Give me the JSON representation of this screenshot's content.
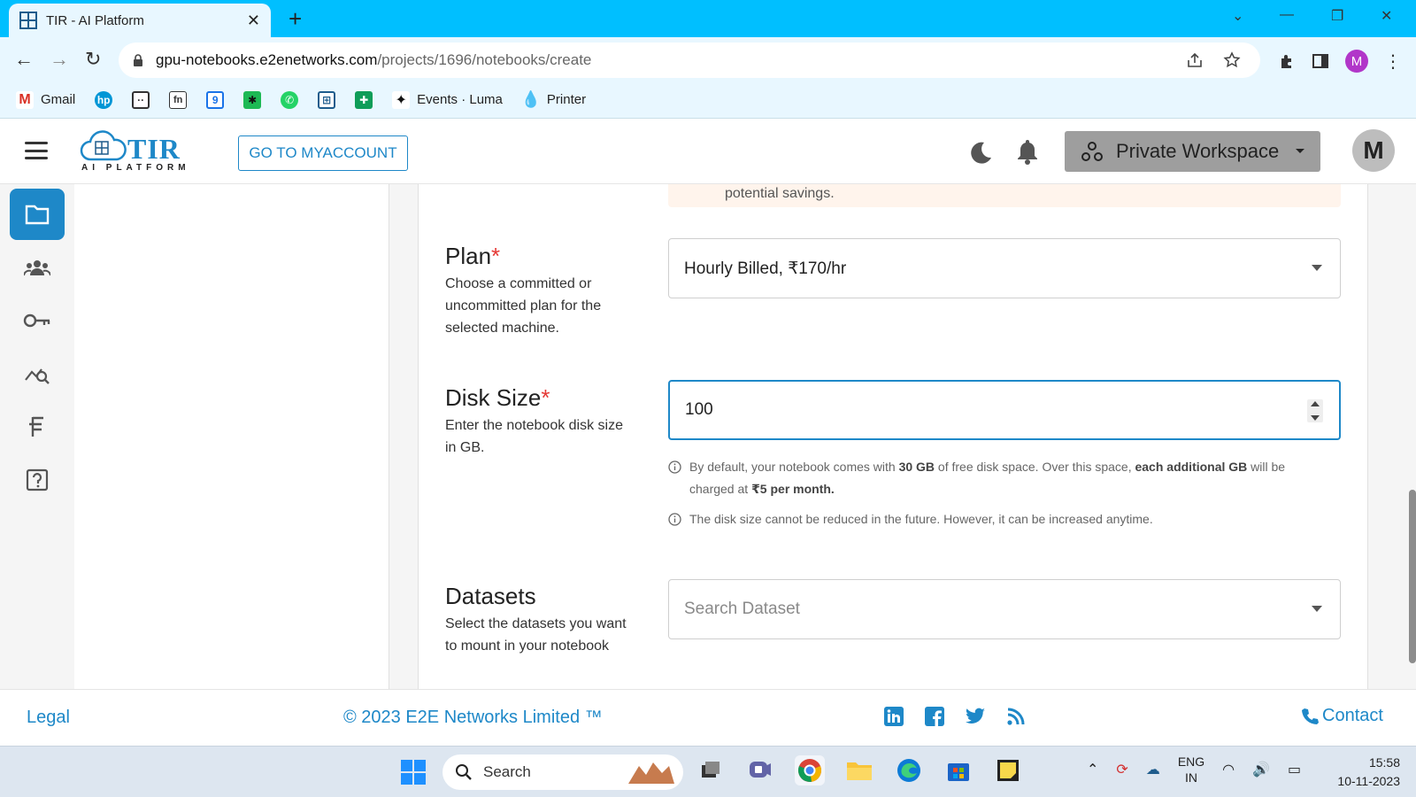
{
  "browser": {
    "tab_title": "TIR - AI Platform",
    "url_host": "gpu-notebooks.e2enetworks.com",
    "url_path": "/projects/1696/notebooks/create",
    "profile_initial": "M",
    "bookmarks": [
      {
        "label": "Gmail",
        "icon": "gmail-icon"
      },
      {
        "label": "",
        "icon": "hp-icon"
      },
      {
        "label": "",
        "icon": "chat-icon"
      },
      {
        "label": "",
        "icon": "fn-icon"
      },
      {
        "label": "",
        "icon": "calendar-9-icon"
      },
      {
        "label": "",
        "icon": "green-star-icon"
      },
      {
        "label": "",
        "icon": "whatsapp-icon"
      },
      {
        "label": "",
        "icon": "tir-icon"
      },
      {
        "label": "",
        "icon": "sheets-icon"
      },
      {
        "label": "Events · Luma",
        "icon": "luma-icon"
      },
      {
        "label": "Printer",
        "icon": "printer-drop-icon"
      }
    ]
  },
  "header": {
    "logo_text": "TIR",
    "logo_sub": "AI PLATFORM",
    "goto_label": "GO TO MYACCOUNT",
    "workspace_label": "Private Workspace",
    "avatar_initial": "M"
  },
  "alert": {
    "partial_text": "potential savings."
  },
  "form": {
    "plan": {
      "label": "Plan",
      "required_mark": "*",
      "description": "Choose a committed or uncommitted plan for the selected machine.",
      "value": "Hourly Billed, ₹170/hr"
    },
    "disk": {
      "label": "Disk Size",
      "required_mark": "*",
      "description": "Enter the notebook disk size in GB.",
      "value": "100",
      "help1_pre": "By default, your notebook comes with ",
      "help1_b1": "30 GB",
      "help1_mid": " of free disk space. Over this space, ",
      "help1_b2": "each additional GB",
      "help1_post": " will be charged at ",
      "help1_b3": "₹5 per month.",
      "help2": "The disk size cannot be reduced in the future. However, it can be increased anytime."
    },
    "datasets": {
      "label": "Datasets",
      "description": "Select the datasets you want to mount in your notebook",
      "placeholder": "Search Dataset"
    }
  },
  "footer": {
    "legal": "Legal",
    "copyright": "© 2023 E2E Networks Limited ™",
    "contact": "Contact"
  },
  "taskbar": {
    "search_label": "Search",
    "lang_top": "ENG",
    "lang_bottom": "IN",
    "time": "15:58",
    "date": "10-11-2023"
  },
  "colors": {
    "accent": "#1e88c8",
    "tabbar": "#00bfff",
    "required": "#e53935"
  }
}
